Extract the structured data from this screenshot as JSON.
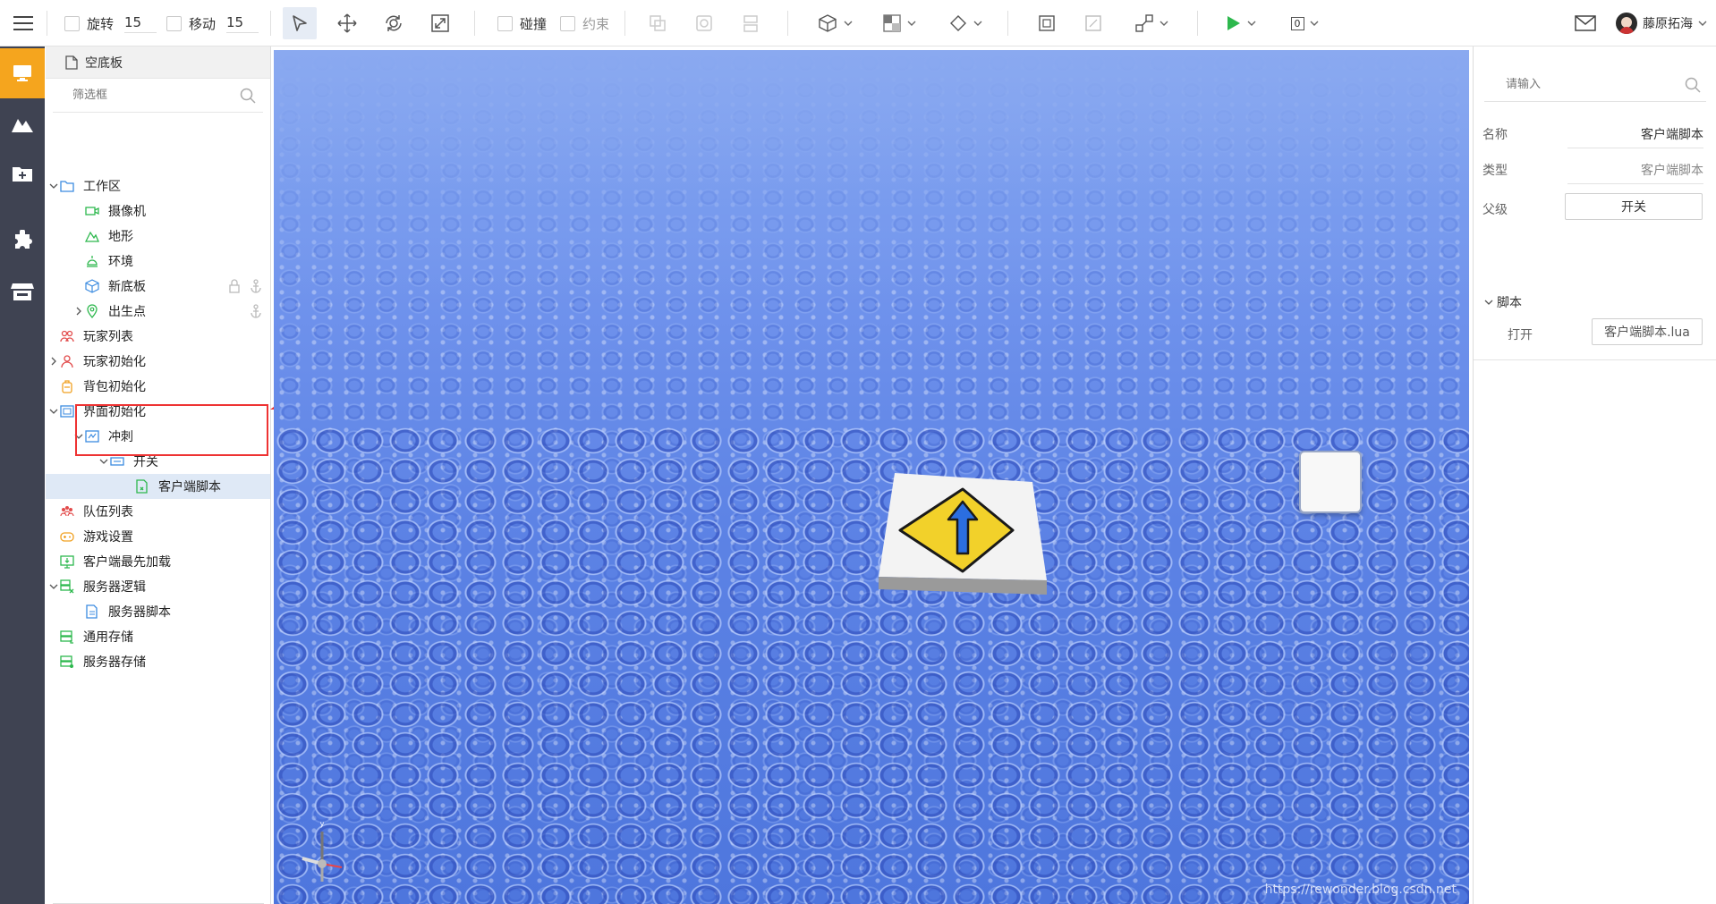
{
  "toolbar": {
    "rotate_label": "旋转",
    "rotate_value": "15",
    "move_label": "移动",
    "move_value": "15",
    "collide_label": "碰撞",
    "constraint_label": "约束",
    "play_count": "0",
    "user_name": "藤原拓海"
  },
  "explorer": {
    "header_label": "空底板",
    "filter_placeholder": "筛选框",
    "nodes": [
      {
        "label": "工作区",
        "icon": "folder-icon"
      },
      {
        "label": "摄像机",
        "icon": "camera-icon"
      },
      {
        "label": "地形",
        "icon": "terrain-icon"
      },
      {
        "label": "环境",
        "icon": "environment-icon"
      },
      {
        "label": "新底板",
        "icon": "cube-icon"
      },
      {
        "label": "出生点",
        "icon": "location-pin-icon"
      },
      {
        "label": "玩家列表",
        "icon": "players-icon"
      },
      {
        "label": "玩家初始化",
        "icon": "player-init-icon"
      },
      {
        "label": "背包初始化",
        "icon": "backpack-icon"
      },
      {
        "label": "界面初始化",
        "icon": "ui-init-icon"
      },
      {
        "label": "冲刺",
        "icon": "ui-group-icon"
      },
      {
        "label": "开关",
        "icon": "button-widget-icon"
      },
      {
        "label": "客户端脚本",
        "icon": "client-script-icon"
      },
      {
        "label": "队伍列表",
        "icon": "teams-icon"
      },
      {
        "label": "游戏设置",
        "icon": "gamepad-icon"
      },
      {
        "label": "客户端最先加载",
        "icon": "client-first-load-icon"
      },
      {
        "label": "服务器逻辑",
        "icon": "server-logic-icon"
      },
      {
        "label": "服务器脚本",
        "icon": "server-script-icon"
      },
      {
        "label": "通用存储",
        "icon": "storage-icon"
      },
      {
        "label": "服务器存储",
        "icon": "server-storage-icon"
      }
    ]
  },
  "properties": {
    "search_placeholder": "请输入",
    "name_label": "名称",
    "name_value": "客户端脚本",
    "type_label": "类型",
    "type_value": "客户端脚本",
    "parent_label": "父级",
    "parent_value": "开关",
    "section_label": "脚本",
    "open_label": "打开",
    "open_value": "客户端脚本.lua"
  },
  "viewport": {
    "watermark": "https://rewonder.blog.csdn.net"
  },
  "colors": {
    "rail_bg": "#3f4352",
    "rail_active": "#f5a51e",
    "selection": "#dfe9f6",
    "highlight": "#e33333",
    "play_green": "#2db84d",
    "sky": "#6f92ec"
  }
}
